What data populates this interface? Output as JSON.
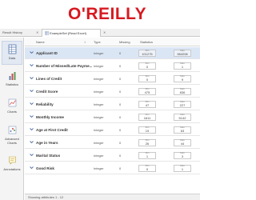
{
  "brand": {
    "logo_text": "O'REILLY",
    "color": "#d71920"
  },
  "tabs": [
    {
      "label": "Result History"
    },
    {
      "label": "ExampleSet (Read Excel)"
    }
  ],
  "sidebar": {
    "items": [
      {
        "label": "Data",
        "icon": "table-icon"
      },
      {
        "label": "Statistics",
        "icon": "statistics-icon"
      },
      {
        "label": "Charts",
        "icon": "charts-icon"
      },
      {
        "label": "Advanced Charts",
        "icon": "advanced-charts-icon"
      },
      {
        "label": "Annotations",
        "icon": "annotations-icon"
      }
    ]
  },
  "columns": {
    "name": "Name",
    "type": "Type",
    "missing": "Missing",
    "statistics": "Statistics"
  },
  "rows": [
    {
      "name": "Applicant ID",
      "type": "Integer",
      "missing": "0",
      "min_label": "Min",
      "min": "101275",
      "max_label": "Max",
      "max": "984208"
    },
    {
      "name": "Number of Missed/Late Payme...",
      "type": "Integer",
      "missing": "0",
      "min_label": "Min",
      "min": "0",
      "max_label": "Max",
      "max": "1"
    },
    {
      "name": "Lines of Credit",
      "type": "Integer",
      "missing": "0",
      "min_label": "Min",
      "min": "0",
      "max_label": "Max",
      "max": "9"
    },
    {
      "name": "Credit Score",
      "type": "Integer",
      "missing": "0",
      "min_label": "Min",
      "min": "475",
      "max_label": "Max",
      "max": "836"
    },
    {
      "name": "Reliability",
      "type": "Integer",
      "missing": "0",
      "min_label": "Min",
      "min": "47",
      "max_label": "Max",
      "max": "227"
    },
    {
      "name": "Monthly Income",
      "type": "Integer",
      "missing": "0",
      "min_label": "Min",
      "min": "1611",
      "max_label": "Max",
      "max": "5142"
    },
    {
      "name": "Age at First Credit",
      "type": "Integer",
      "missing": "0",
      "min_label": "Min",
      "min": "19",
      "max_label": "Max",
      "max": "63"
    },
    {
      "name": "Age in Years",
      "type": "Integer",
      "missing": "0",
      "min_label": "Min",
      "min": "26",
      "max_label": "Max",
      "max": "44"
    },
    {
      "name": "Marital Status",
      "type": "Integer",
      "missing": "0",
      "min_label": "Min",
      "min": "1",
      "max_label": "Max",
      "max": "3"
    },
    {
      "name": "Good Risk",
      "type": "Integer",
      "missing": "0",
      "min_label": "Min",
      "min": "0",
      "max_label": "Max",
      "max": "1"
    }
  ],
  "status_text": "Showing attributes 1 - 12"
}
